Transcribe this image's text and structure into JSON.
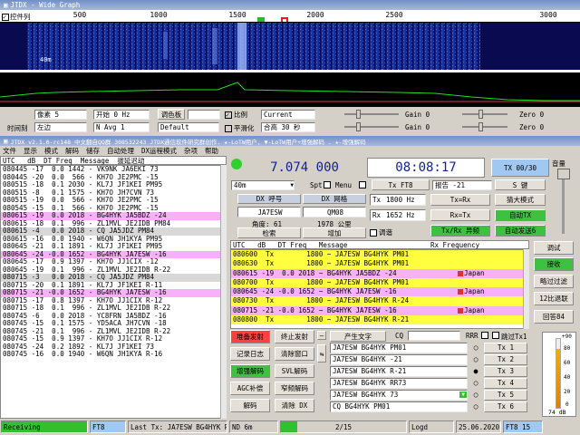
{
  "wide": {
    "title": "JTDX - Wide Graph",
    "checkbox_label": "控件列",
    "ruler": [
      "500",
      "1000",
      "1500",
      "2000",
      "2500",
      "3000"
    ],
    "wf_label": "40m"
  },
  "wgctl": {
    "bins_label": "像素 5",
    "start": "开始 0 Hz",
    "palette_btn": "调色板",
    "palette_val": "Default",
    "ratio_label": "比例",
    "current": "Current",
    "smooth_label": "平滑化",
    "gain0": "Gain 0",
    "zero0": "Zero 0",
    "gain1": "Gain 0",
    "zero1": "Zero 0",
    "interval_label": "时间刻",
    "left": "左边",
    "navg": "N Avg 1",
    "timeinfo": "合高 30 秒",
    "menu_label": "调色板"
  },
  "main": {
    "title": "JTDX   v2.1.0-rc148 中文翻自QQ群 308532243 JTDX通信软件研究群创作. ★-LoTW用户, ▼-LoTW用户+增强解码 . ★-增强解码",
    "menu": [
      "文件",
      "显示",
      "模式",
      "解码",
      "储存",
      "自动处理",
      "DX运程模式",
      "杂项",
      "帮助"
    ],
    "colhdr": "UTC   dB  DT Freq  Message",
    "colhdr2": "  拔延迟动",
    "decodes": [
      {
        "t": "080445 -17  0.0 1442 - VK9NK JA6EKI 73",
        "c": "#fff"
      },
      {
        "t": "080445 -20  0.0  566 - KH7O JE2PMC -15",
        "c": "#fff"
      },
      {
        "t": "080515 -18  0.1 2030 - KL7J JF1KEI PM95",
        "c": "#fff"
      },
      {
        "t": "080515 -8   0.1 1575 - KH7O JH7CVN 73",
        "c": "#fff"
      },
      {
        "t": "080515 -19  0.0  566 - KH7O JE2PMC -15",
        "c": "#fff"
      },
      {
        "t": "080545 -15  0.1  566 - KH7O JE2PMC -15",
        "c": "#fff"
      },
      {
        "t": "080615 -19  0.0 2018 - BG4HYK JA5BDZ -24",
        "c": "#f8b0f8"
      },
      {
        "t": "080615 -18  0.1  996 - ZL1MVL JE2IDB PM84",
        "c": "#fff"
      },
      {
        "t": "080615 -4   0.0 2018 - CQ JA5JDZ PM84",
        "c": "#d8d8d8"
      },
      {
        "t": "080615 -16  0.0 1940 - W6QN JH1KYA PM95",
        "c": "#fff"
      },
      {
        "t": "080645 -21  0.1 1891 - KL7J JF1KEI PM95",
        "c": "#fff"
      },
      {
        "t": "080645 -24 -0.0 1652 - BG4HYK JA7ESW -16",
        "c": "#f8b0f8"
      },
      {
        "t": "080645 -17  0.9 1397 - KH7O JJ1CIX -12",
        "c": "#fff"
      },
      {
        "t": "080645 -19  0.1  996 - ZL1MVL JE2IDB R-22",
        "c": "#fff"
      },
      {
        "t": "080715 -3   0.0 2018 - CQ JA5JDZ PM84",
        "c": "#d8d8d8"
      },
      {
        "t": "080715 -20  0.1 1891 - KL7J JF1KEI R-11",
        "c": "#fff"
      },
      {
        "t": "080715 -21 -0.0 1652 - BG4HYK JA7ESW -16",
        "c": "#f8b0f8"
      },
      {
        "t": "080715 -17  0.8 1397 - KH7O JJ1CIX R-12",
        "c": "#fff"
      },
      {
        "t": "080715 -18  0.1  996 - ZL1MVL JE2IDB R-22",
        "c": "#fff"
      },
      {
        "t": "080745 -6   0.0 2018 - YC8FRN JA5BDZ -16",
        "c": "#fff"
      },
      {
        "t": "080745 -15  0.1 1575 - YD5ACA JH7CVN -18",
        "c": "#fff"
      },
      {
        "t": "080745 -21  0.1  996 - ZL1MVL JE2IDB R-22",
        "c": "#fff"
      },
      {
        "t": "080745 -15  0.9 1397 - KH7O JJ1CIX R-12",
        "c": "#fff"
      },
      {
        "t": "080745 -24  0.2 1892 - KL7J JF1KEI 73",
        "c": "#fff"
      },
      {
        "t": "080745 -16  0.0 1940 - W6QN JH1KYA R-16",
        "c": "#fff"
      }
    ],
    "freq": "7.074 000",
    "time": "08:08:17",
    "tx_btn": "TX 00/30",
    "vol_label": "音量",
    "band": "40m",
    "spt": "Spt",
    "menu_lbl": "Menu",
    "tx_mode": "Tx FT8",
    "report": "报告 -21",
    "s_btn": "S 键",
    "dxcall_lbl": "DX 呼号",
    "dxgrid_lbl": "DX 网格",
    "dxcall": "JA7ESW",
    "dxgrid": "QM08",
    "angle": "角度: 61",
    "dist": "1978 公里",
    "lookup": "检索",
    "add": "增加",
    "tx_hz_lbl": "Tx",
    "tx_hz": "1800  Hz",
    "rx_hz_lbl": "Rx",
    "rx_hz": "1652  Hz",
    "txeqrx": "Tx=Rx",
    "rxeqtx": "Rx=Tx",
    "hold_lbl": "调谐",
    "txrx_split": "Tx/Rx 异频",
    "autotx": "自动TX",
    "autoseq": "自动发送6",
    "guess": "猜大模式",
    "qhdr": "UTC   dB   DT Freq   Message",
    "qhdr2": "Rx Frequency",
    "qso": [
      {
        "t": "080600  Tx        1800 ~ JA7ESW BG4HYK PM01",
        "c": "#ffff40",
        "f": ""
      },
      {
        "t": "080630  Tx        1800 ~ JA7ESW BG4HYK PM01",
        "c": "#ffff40",
        "f": ""
      },
      {
        "t": "080615 -19  0.0 2018 ~ BG4HYK JA5BDZ -24",
        "c": "#f8b0f8",
        "f": "Japan"
      },
      {
        "t": "080700  Tx        1800 ~ JA7ESW BG4HYK PM01",
        "c": "#ffff40",
        "f": ""
      },
      {
        "t": "080645 -24 -0.0 1652 ~ BG4HYK JA7ESW -16",
        "c": "#f8b0f8",
        "f": "Japan"
      },
      {
        "t": "080730  Tx        1800 ~ JA7ESW BG4HYK R-24",
        "c": "#ffff40",
        "f": ""
      },
      {
        "t": "080715 -21 -0.0 1652 ~ BG4HYK JA7ESW -16",
        "c": "#f8b0f8",
        "f": "Japan"
      },
      {
        "t": "080800  Tx        1800 ~ JA7ESW BG4HYK R-21",
        "c": "#ffff40",
        "f": ""
      }
    ],
    "side": [
      "调试",
      "接收",
      "略过过滤",
      "12比退联",
      "回答84"
    ],
    "enable_tx": "堆备发射",
    "halt_tx": "终止发射",
    "log": "记录日志",
    "clear": "清除窗口",
    "enh_dec": "增强解码",
    "svl": "SVL解码",
    "agc": "AGC补偿",
    "narrow": "窄频解码",
    "decode": "解码",
    "clear_dx": "清除 DX",
    "gen": "产生文字",
    "cq": "CQ",
    "rrr": "RRR",
    "skip_tx1": "跳过Tx1",
    "txmsg": [
      "JA7ESW BG4HYK PM01",
      "JA7ESW BG4HYK -21",
      "JA7ESW BG4HYK R-21",
      "JA7ESW BG4HYK RR73",
      "JA7ESW BG4HYK 73",
      "CQ BG4HYK PM01"
    ],
    "txbtn": [
      "Tx 1",
      "Tx 2",
      "Tx 3",
      "Tx 4",
      "Tx 5",
      "Tx 6"
    ],
    "meter": [
      "+90",
      "80",
      "60",
      "40",
      "20",
      "0"
    ],
    "meter_db": "74 dB",
    "status": {
      "state": "Receiving",
      "mode": "FT8",
      "last_tx": "Last Tx: JA7ESW BG4HYK R-21",
      "nd": "ND 6m",
      "prog": "2/15",
      "logd": "Logd",
      "date": "25.06.2020",
      "ft": "FT8  15"
    }
  }
}
